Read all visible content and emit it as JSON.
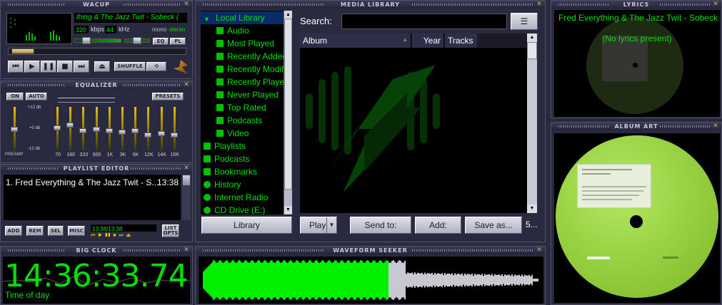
{
  "player": {
    "title": "WACUP",
    "ticker": "thing & The Jazz Twit - Sobeck (",
    "kbps_value": "320",
    "kbps_label": "kbps",
    "khz_value": "44",
    "khz_label": "kHz",
    "mono": "mono",
    "stereo": "stereo",
    "eq_toggle": "EQ",
    "pl_toggle": "PL",
    "shuffle": "SHUFFLE"
  },
  "equalizer": {
    "title": "EQUALIZER",
    "on": "ON",
    "auto": "AUTO",
    "presets": "PRESETS",
    "db_top": "+12 db",
    "db_mid": "+0 db",
    "db_bottom": "-12 db",
    "preamp": "PREAMP",
    "bands": [
      "70",
      "180",
      "320",
      "600",
      "1K",
      "3K",
      "6K",
      "12K",
      "14K",
      "16K"
    ]
  },
  "playlist": {
    "title": "PLAYLIST EDITOR",
    "items": [
      {
        "text": "1. Fred Everything & The Jazz Twit - S...",
        "duration": "13:38"
      }
    ],
    "add": "ADD",
    "rem": "REM",
    "sel": "SEL",
    "misc": "MISC",
    "time": "13:38/13:38",
    "list_opts_1": "LIST",
    "list_opts_2": "OPTS"
  },
  "big_clock": {
    "title": "BIG CLOCK",
    "time": "14:36:33.74",
    "label": "Time of day"
  },
  "media_library": {
    "title": "MEDIA LIBRARY",
    "tree": [
      {
        "label": "Local Library",
        "level": 0,
        "icon": "triangle-down-icon"
      },
      {
        "label": "Audio",
        "level": 1,
        "icon": "music-note-icon"
      },
      {
        "label": "Most Played",
        "level": 1,
        "icon": "playlist-icon"
      },
      {
        "label": "Recently Added",
        "level": 1,
        "icon": "playlist-icon"
      },
      {
        "label": "Recently Modified",
        "level": 1,
        "icon": "playlist-icon"
      },
      {
        "label": "Recently Played",
        "level": 1,
        "icon": "playlist-icon"
      },
      {
        "label": "Never Played",
        "level": 1,
        "icon": "playlist-icon"
      },
      {
        "label": "Top Rated",
        "level": 1,
        "icon": "playlist-icon"
      },
      {
        "label": "Podcasts",
        "level": 1,
        "icon": "playlist-icon"
      },
      {
        "label": "Video",
        "level": 1,
        "icon": "video-icon"
      },
      {
        "label": "Playlists",
        "level": 0,
        "icon": "playlist-icon"
      },
      {
        "label": "Podcasts",
        "level": 0,
        "icon": "podcast-icon"
      },
      {
        "label": "Bookmarks",
        "level": 0,
        "icon": "bookmark-icon"
      },
      {
        "label": "History",
        "level": 0,
        "icon": "history-icon"
      },
      {
        "label": "Internet Radio",
        "level": 0,
        "icon": "radio-icon"
      },
      {
        "label": "CD Drive (E:)",
        "level": 0,
        "icon": "cd-icon"
      }
    ],
    "library_button": "Library",
    "search_label": "Search:",
    "search_value": "",
    "menu_button": "☰",
    "columns": [
      "Album",
      "Year",
      "Tracks"
    ],
    "play": "Play",
    "send_to": "Send to:",
    "add": "Add:",
    "save_as": "Save as...",
    "status": "5..."
  },
  "waveform": {
    "title": "WAVEFORM SEEKER",
    "progress": 0.55
  },
  "lyrics": {
    "title": "LYRICS",
    "track": "Fred Everything & The Jazz Twit - Sobeck",
    "message": "(No lyrics present)"
  },
  "album_art": {
    "title": "ALBUM ART"
  },
  "colors": {
    "accent": "#00e000",
    "panel": "#292940",
    "vinyl_label": "#9ed641"
  }
}
